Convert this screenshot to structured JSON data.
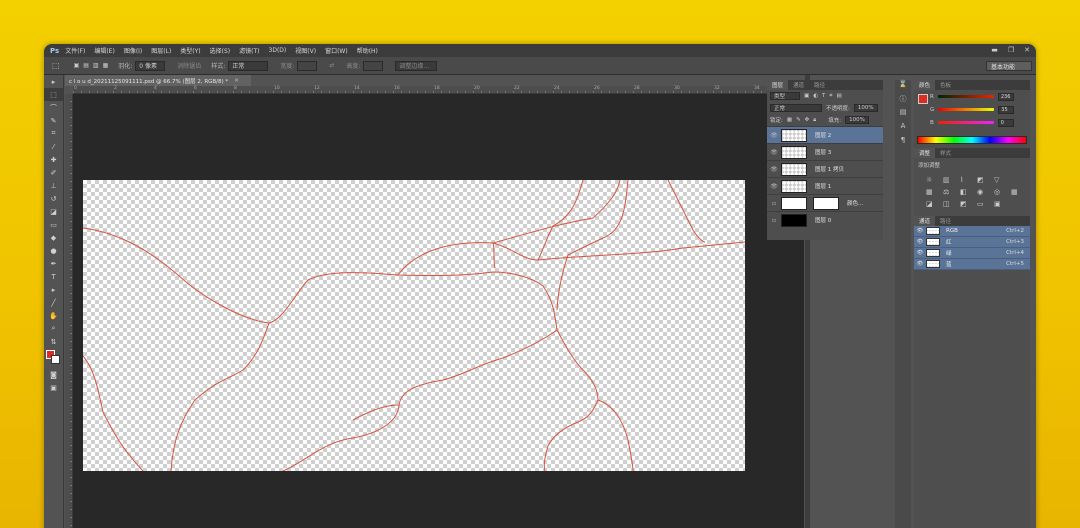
{
  "app": {
    "logo": "Ps",
    "menu": [
      "文件(F)",
      "编辑(E)",
      "图像(I)",
      "图层(L)",
      "类型(Y)",
      "选择(S)",
      "滤镜(T)",
      "3D(D)",
      "视图(V)",
      "窗口(W)",
      "帮助(H)"
    ],
    "window_controls": [
      "▬",
      "❐",
      "✕"
    ]
  },
  "options_bar": {
    "feather_label": "羽化:",
    "feather_value": "0 像素",
    "antialias_label": "消除锯齿",
    "style_label": "样式:",
    "style_value": "正常",
    "width_label": "宽度:",
    "height_label": "高度:",
    "refine_edge": "调整边缘...",
    "workspace": "基本功能"
  },
  "document": {
    "tab_title": "c l o u d_20211125091111.psd @ 66.7% (图层 2, RGB/8) *",
    "ruler_numbers": [
      "0",
      "2",
      "4",
      "6",
      "8",
      "10",
      "12",
      "14",
      "16",
      "18",
      "20",
      "22",
      "24",
      "26",
      "28",
      "30",
      "32",
      "34"
    ]
  },
  "layers_panel": {
    "tabs": [
      "图层",
      "通道",
      "路径"
    ],
    "filter_kind": "类型",
    "blend_mode": "正常",
    "opacity_label": "不透明度:",
    "opacity_value": "100%",
    "lock_label": "锁定:",
    "fill_label": "填充:",
    "fill_value": "100%",
    "layers": [
      {
        "name": "图层 2",
        "visible": true,
        "selected": true,
        "thumb": "transparent"
      },
      {
        "name": "图层 3",
        "visible": true,
        "selected": false,
        "thumb": "transparent"
      },
      {
        "name": "图层 1 拷贝",
        "visible": true,
        "selected": false,
        "thumb": "transparent"
      },
      {
        "name": "图层 1",
        "visible": true,
        "selected": false,
        "thumb": "transparent"
      },
      {
        "name": "颜色...",
        "visible": false,
        "selected": false,
        "thumb": "white"
      },
      {
        "name": "图层 0",
        "visible": false,
        "selected": false,
        "thumb": "black"
      }
    ]
  },
  "color_panel": {
    "tabs": [
      "颜色",
      "色板"
    ],
    "r": {
      "label": "R",
      "value": "236"
    },
    "g": {
      "label": "G",
      "value": "35"
    },
    "b": {
      "label": "B",
      "value": "0"
    }
  },
  "adjustments_panel": {
    "tabs": [
      "调整",
      "样式"
    ],
    "title": "添加调整"
  },
  "channels_panel": {
    "tabs": [
      "通道",
      "路径"
    ],
    "channels": [
      {
        "name": "RGB",
        "shortcut": "Ctrl+2"
      },
      {
        "name": "红",
        "shortcut": "Ctrl+3"
      },
      {
        "name": "绿",
        "shortcut": "Ctrl+4"
      },
      {
        "name": "蓝",
        "shortcut": "Ctrl+5"
      }
    ]
  },
  "colors": {
    "foreground": "#dd2d21",
    "crack_line": "#d9533f",
    "selection": "#5a7498"
  }
}
